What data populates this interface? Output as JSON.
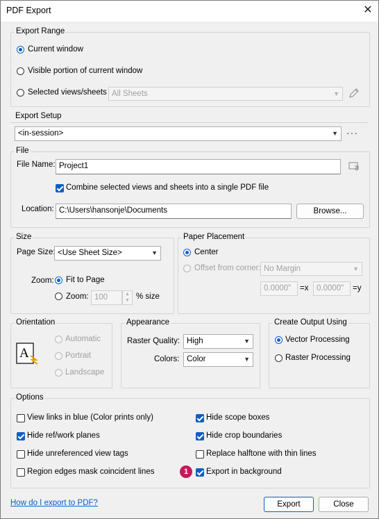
{
  "window": {
    "title": "PDF Export",
    "close_glyph": "✕"
  },
  "export_range": {
    "title": "Export Range",
    "current_window": "Current window",
    "visible_portion": "Visible portion of current window",
    "selected_views": "Selected views/sheets",
    "sheets_combo": "All Sheets"
  },
  "export_setup": {
    "title": "Export Setup",
    "value": "<in-session>",
    "more": "···"
  },
  "file": {
    "title": "File",
    "name_label": "File Name:",
    "name_value": "Project1",
    "combine_label": "Combine selected views and sheets into a single PDF file",
    "location_label": "Location:",
    "location_value": "C:\\Users\\hansonje\\Documents",
    "browse": "Browse..."
  },
  "size": {
    "title": "Size",
    "page_size_label": "Page Size:",
    "page_size_value": "<Use Sheet Size>",
    "zoom_label": "Zoom:",
    "fit_to_page": "Fit to Page",
    "zoom_option": "Zoom:",
    "zoom_value": "100",
    "zoom_unit": "% size"
  },
  "paper_placement": {
    "title": "Paper Placement",
    "center": "Center",
    "offset": "Offset from corner:",
    "margin_value": "No Margin",
    "x_value": "0.0000\"",
    "x_label": "=x",
    "y_value": "0.0000\"",
    "y_label": "=y"
  },
  "orientation": {
    "title": "Orientation",
    "automatic": "Automatic",
    "portrait": "Portrait",
    "landscape": "Landscape"
  },
  "appearance": {
    "title": "Appearance",
    "raster_label": "Raster Quality:",
    "raster_value": "High",
    "colors_label": "Colors:",
    "colors_value": "Color"
  },
  "create_output": {
    "title": "Create Output Using",
    "vector": "Vector Processing",
    "raster": "Raster Processing"
  },
  "options": {
    "title": "Options",
    "view_links": "View links in blue (Color prints only)",
    "hide_ref": "Hide ref/work planes",
    "hide_unref": "Hide unreferenced view tags",
    "region_edges": "Region edges mask coincident lines",
    "hide_scope": "Hide scope boxes",
    "hide_crop": "Hide crop boundaries",
    "replace_halftone": "Replace halftone with thin lines",
    "export_bg": "Export in background",
    "badge": "1"
  },
  "footer": {
    "help_link": "How do I export to PDF?",
    "export": "Export",
    "close": "Close"
  }
}
